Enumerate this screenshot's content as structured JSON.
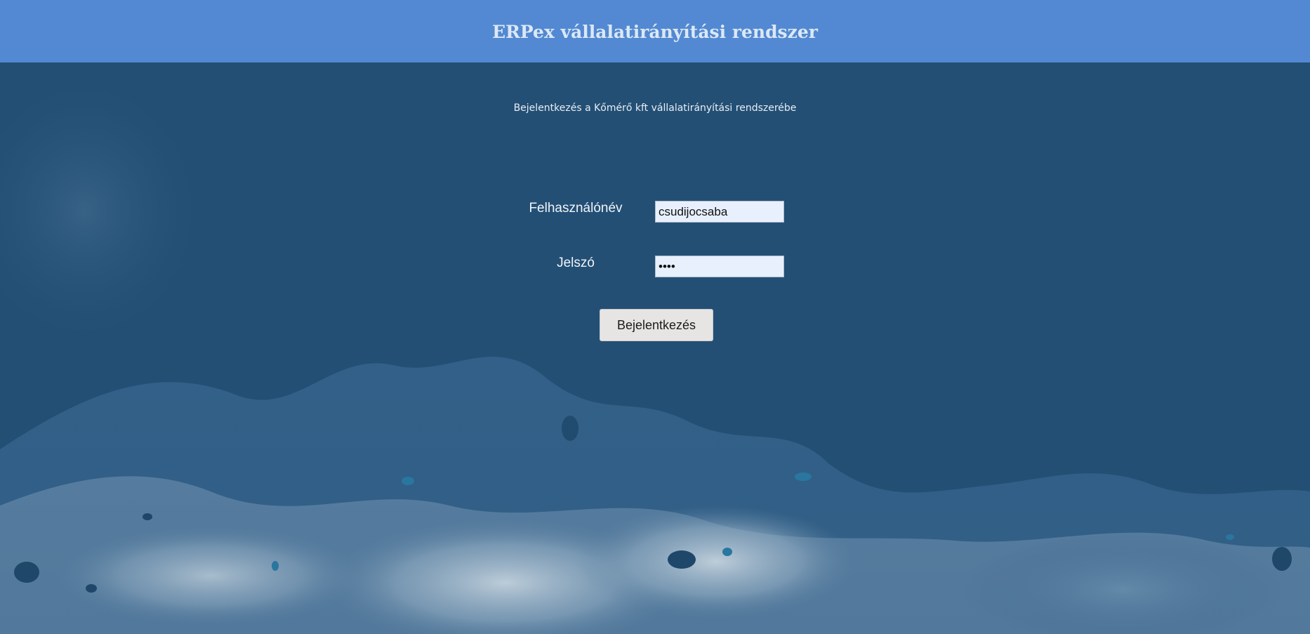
{
  "header": {
    "title": "ERPex vállalatirányítási rendszer"
  },
  "login": {
    "subtitle": "Bejelentkezés a Kőmérő kft vállalatirányítási rendszerébe",
    "username_label": "Felhasználónév",
    "username_value": "csudijocsaba",
    "password_label": "Jelszó",
    "password_value": "abcd",
    "submit_label": "Bejelentkezés"
  },
  "colors": {
    "header_bg": "#5289d2",
    "page_bg": "#234f75",
    "input_bg": "#e8f0fe",
    "button_bg": "#e7e5e4"
  }
}
